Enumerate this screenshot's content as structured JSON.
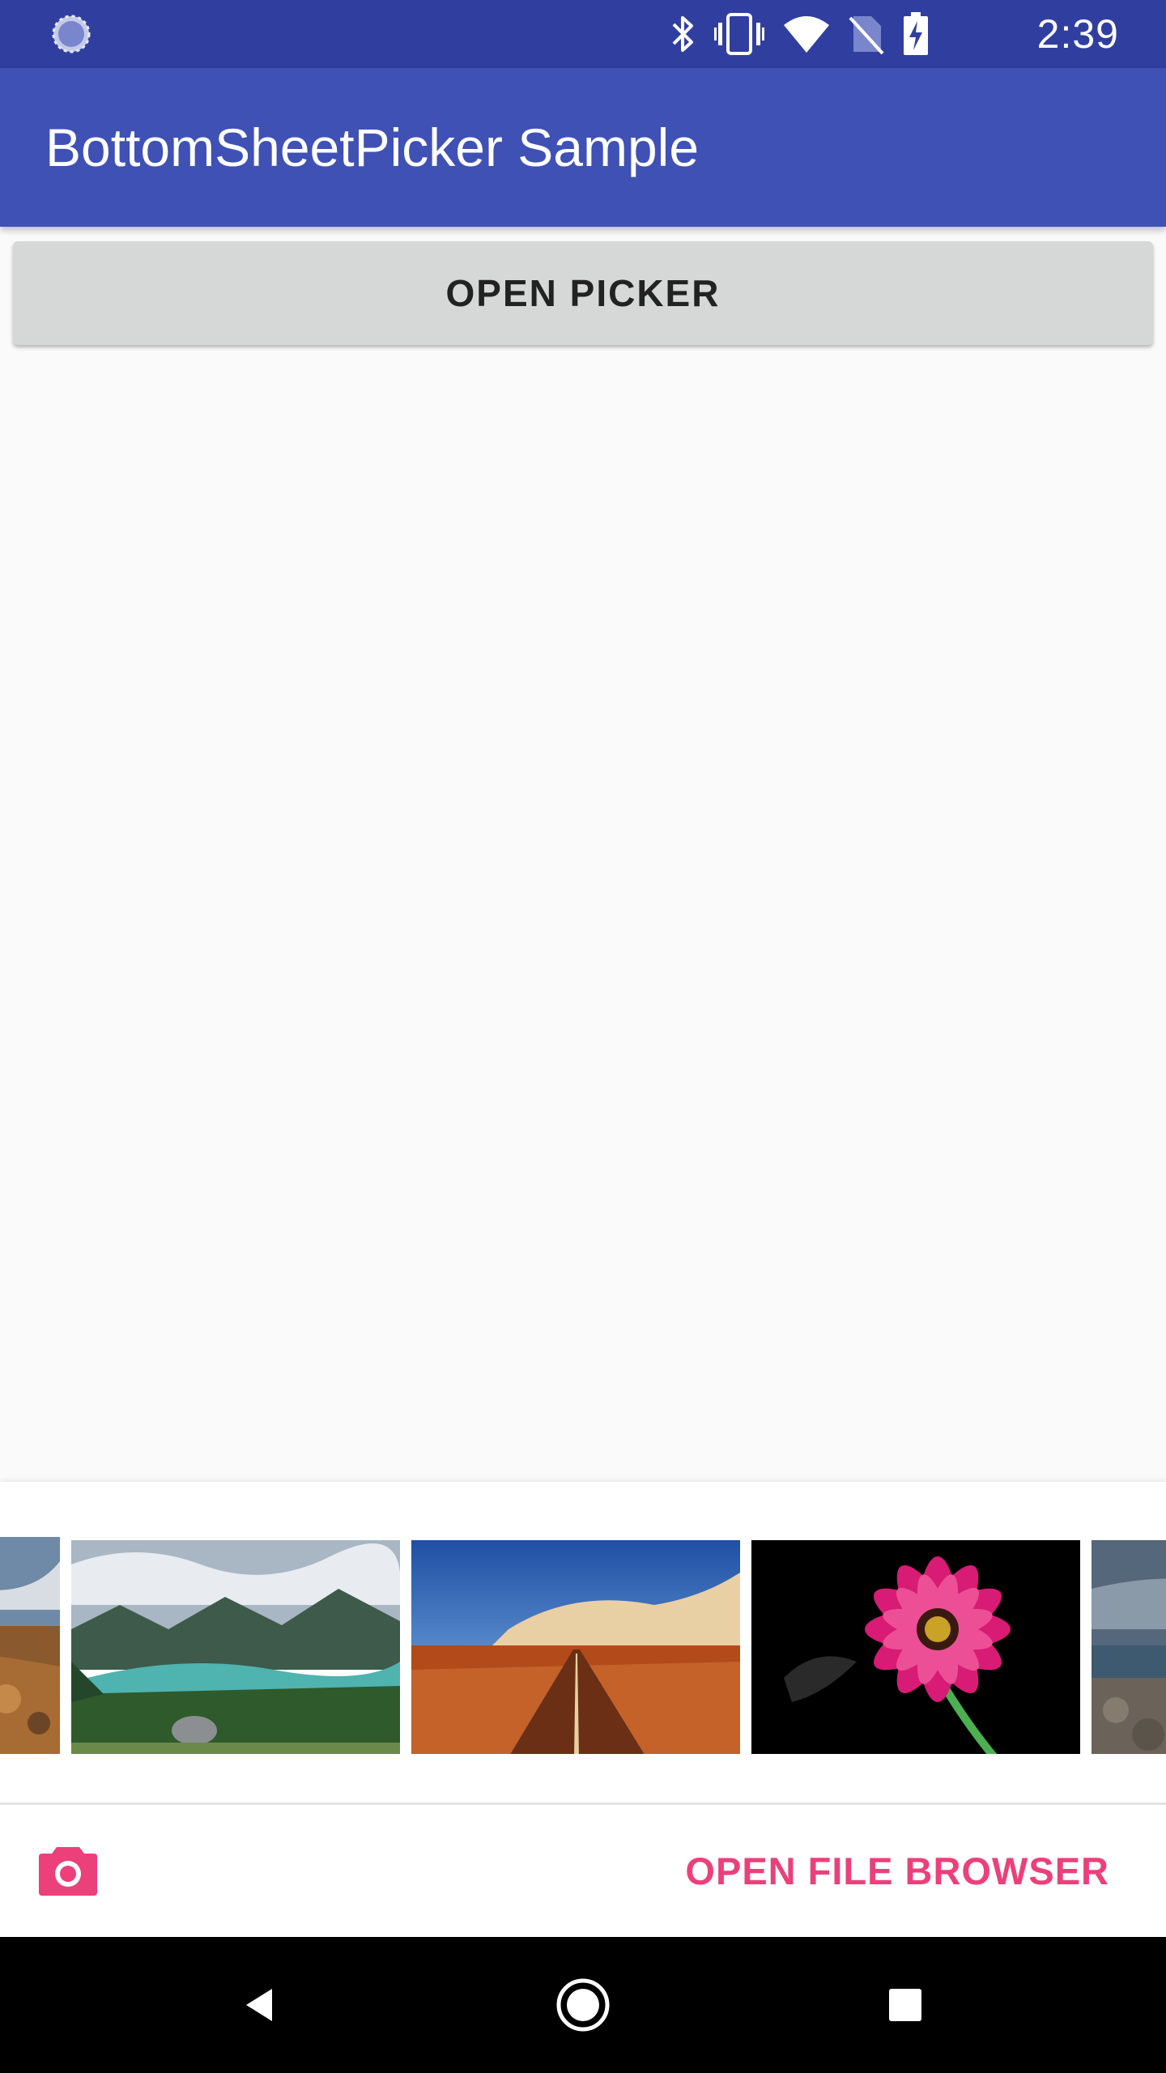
{
  "status_bar": {
    "time": "2:39",
    "icons": [
      "sync-icon",
      "bluetooth-icon",
      "vibrate-icon",
      "wifi-icon",
      "no-sim-icon",
      "battery-charging-icon"
    ]
  },
  "app_bar": {
    "title": "BottomSheetPicker Sample"
  },
  "main": {
    "open_picker_label": "OPEN PICKER"
  },
  "bottom_sheet": {
    "thumbnails": [
      {
        "name": "partial-landscape-thumbnail",
        "subject": "cloudy sky over autumn field"
      },
      {
        "name": "mountain-lake-thumbnail",
        "subject": "turquoise lake between forested mountains"
      },
      {
        "name": "desert-road-thumbnail",
        "subject": "straight road through red desert under blue sky"
      },
      {
        "name": "pink-flower-thumbnail",
        "subject": "pink daisy on black background"
      },
      {
        "name": "partial-beach-thumbnail",
        "subject": "rocky shore under cloudy sky"
      }
    ],
    "camera_icon": "camera-icon",
    "file_browser_label": "OPEN FILE BROWSER"
  },
  "nav_bar": {
    "icons": [
      "back-icon",
      "home-icon",
      "recents-icon"
    ]
  },
  "colors": {
    "status_bar": "#303f9f",
    "app_bar": "#3f51b5",
    "accent": "#ec407a",
    "button": "#d6d7d7",
    "background": "#fafafa"
  }
}
